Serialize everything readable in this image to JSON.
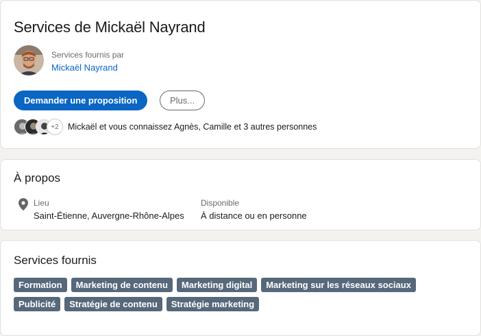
{
  "header": {
    "title": "Services de Mickaël Nayrand",
    "provider_caption": "Services fournis par",
    "provider_name": "Mickaël Nayrand",
    "primary_button": "Demander une proposition",
    "secondary_button": "Plus...",
    "connections_count": "+2",
    "connections_text": "Mickaël et vous connaissez Agnès, Camille et 3 autres personnes"
  },
  "about": {
    "title": "À propos",
    "location_label": "Lieu",
    "location_value": "Saint-Étienne, Auvergne-Rhône-Alpes",
    "availability_label": "Disponible",
    "availability_value": "À distance ou en personne"
  },
  "services": {
    "title": "Services fournis",
    "tags": [
      "Formation",
      "Marketing de contenu",
      "Marketing digital",
      "Marketing sur les réseaux sociaux",
      "Publicité",
      "Stratégie de contenu",
      "Stratégie marketing"
    ]
  },
  "colors": {
    "accent": "#0a66c2",
    "tag_background": "#56687a",
    "page_background": "#f3f2ef"
  }
}
